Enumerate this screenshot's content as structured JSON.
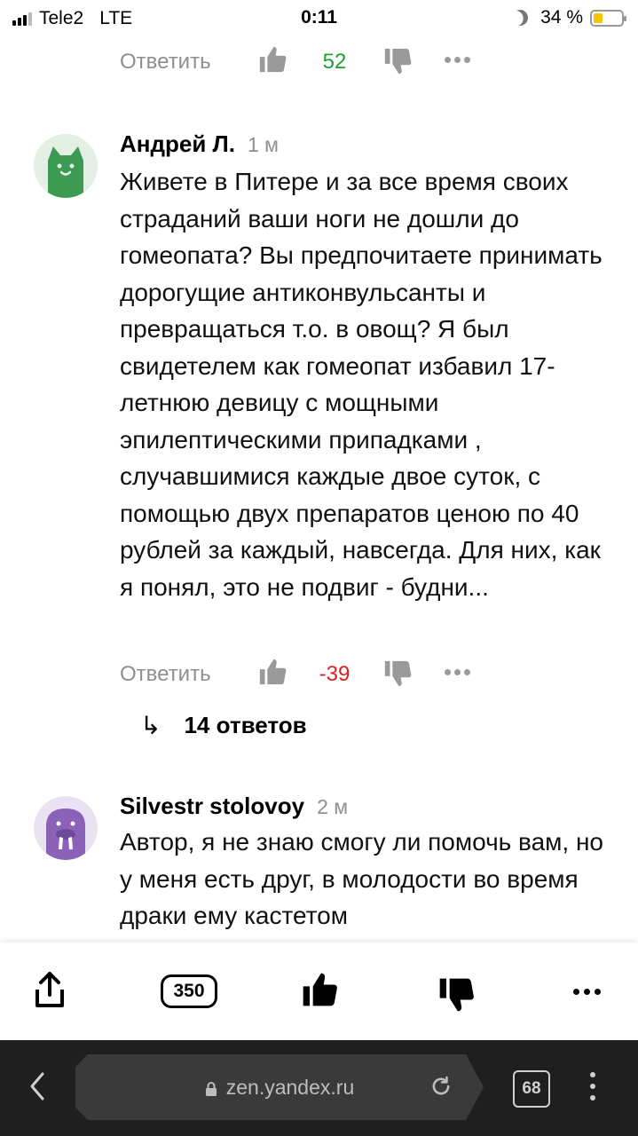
{
  "status_bar": {
    "carrier": "Tele2",
    "network": "LTE",
    "time": "0:11",
    "battery_percent": "34 %",
    "battery_level": 0.34,
    "icons": [
      "signal-icon",
      "moon-icon",
      "battery-icon"
    ]
  },
  "top_actions": {
    "reply_label": "Ответить",
    "score": "52",
    "score_color": "#1fa12f"
  },
  "comments": [
    {
      "author": "Андрей Л.",
      "age": "1 м",
      "avatar_icon": "cat-avatar-icon",
      "avatar_color": "#3d9a52",
      "text": "Живете в Питере и за все время своих страданий ваши ноги не дошли до гомеопата? Вы предпочитаете принимать дорогущие антиконвульсанты и превращаться т.о. в овощ? Я был свидетелем как гомеопат избавил 17-летнюю девицу с мощными эпилептическими припадками , случавшимися каждые двое суток, с помощью двух препаратов ценою по 40 рублей за каждый, навсегда. Для них, как я понял, это не подвиг - будни...",
      "reply_label": "Ответить",
      "score": "-39",
      "score_color": "#e02020",
      "replies_label": "14 ответов"
    },
    {
      "author": "Silvestr stolovoy",
      "age": "2 м",
      "avatar_icon": "walrus-avatar-icon",
      "avatar_color": "#8c62b8",
      "text": "Автор, я не знаю смогу ли помочь вам, но у меня есть друг, в молодости во время драки ему кастетом"
    }
  ],
  "article_toolbar": {
    "comments_count": "350",
    "icons": [
      "share-icon",
      "comments-count-icon",
      "like-icon",
      "dislike-icon",
      "more-icon"
    ]
  },
  "browser_bar": {
    "url": "zen.yandex.ru",
    "tabs_count": "68",
    "icons": [
      "back-icon",
      "lock-icon",
      "reload-icon",
      "tabs-icon",
      "menu-icon"
    ]
  }
}
